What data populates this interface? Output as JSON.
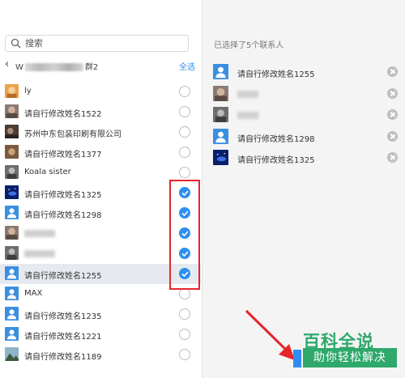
{
  "search": {
    "placeholder": "搜索"
  },
  "group": {
    "name_prefix": "W",
    "name_suffix": "群2",
    "select_all": "全选"
  },
  "contacts": [
    {
      "name": "ly",
      "avatar": "orange-photo",
      "checked": false
    },
    {
      "name": "请自行修改姓名1522",
      "avatar": "portrait-photo",
      "checked": false
    },
    {
      "name": "苏州中东包装印刷有限公司",
      "avatar": "dark-photo",
      "checked": false
    },
    {
      "name": "请自行修改姓名1377",
      "avatar": "brown-photo",
      "checked": false
    },
    {
      "name": "Koala sister",
      "avatar": "grey-photo",
      "checked": false
    },
    {
      "name": "请自行修改姓名1325",
      "avatar": "blue-galaxy-photo",
      "checked": true
    },
    {
      "name": "请自行修改姓名1298",
      "avatar": "default-person",
      "checked": true
    },
    {
      "name": "",
      "avatar": "portrait-photo",
      "checked": true
    },
    {
      "name": "",
      "avatar": "grey-photo",
      "checked": true
    },
    {
      "name": "请自行修改姓名1255",
      "avatar": "default-person",
      "checked": true
    },
    {
      "name": "MAX",
      "avatar": "default-person",
      "checked": false
    },
    {
      "name": "请自行修改姓名1235",
      "avatar": "default-person",
      "checked": false
    },
    {
      "name": "请自行修改姓名1221",
      "avatar": "default-person",
      "checked": false
    },
    {
      "name": "请自行修改姓名1189",
      "avatar": "landscape-photo",
      "checked": false
    }
  ],
  "selected_title": "已选择了5个联系人",
  "selected": [
    {
      "name": "请自行修改姓名1255",
      "avatar": "default-person"
    },
    {
      "name": "",
      "avatar": "portrait-photo"
    },
    {
      "name": "",
      "avatar": "grey-photo"
    },
    {
      "name": "请自行修改姓名1298",
      "avatar": "default-person"
    },
    {
      "name": "请自行修改姓名1325",
      "avatar": "blue-galaxy-photo"
    }
  ],
  "watermark": {
    "title": "百科全说",
    "subtitle": "助你轻松解决"
  },
  "colors": {
    "accent": "#2f8ff0",
    "highlight": "#e6eaf0",
    "annotation": "#e5262a",
    "watermark": "#2ea86b"
  }
}
